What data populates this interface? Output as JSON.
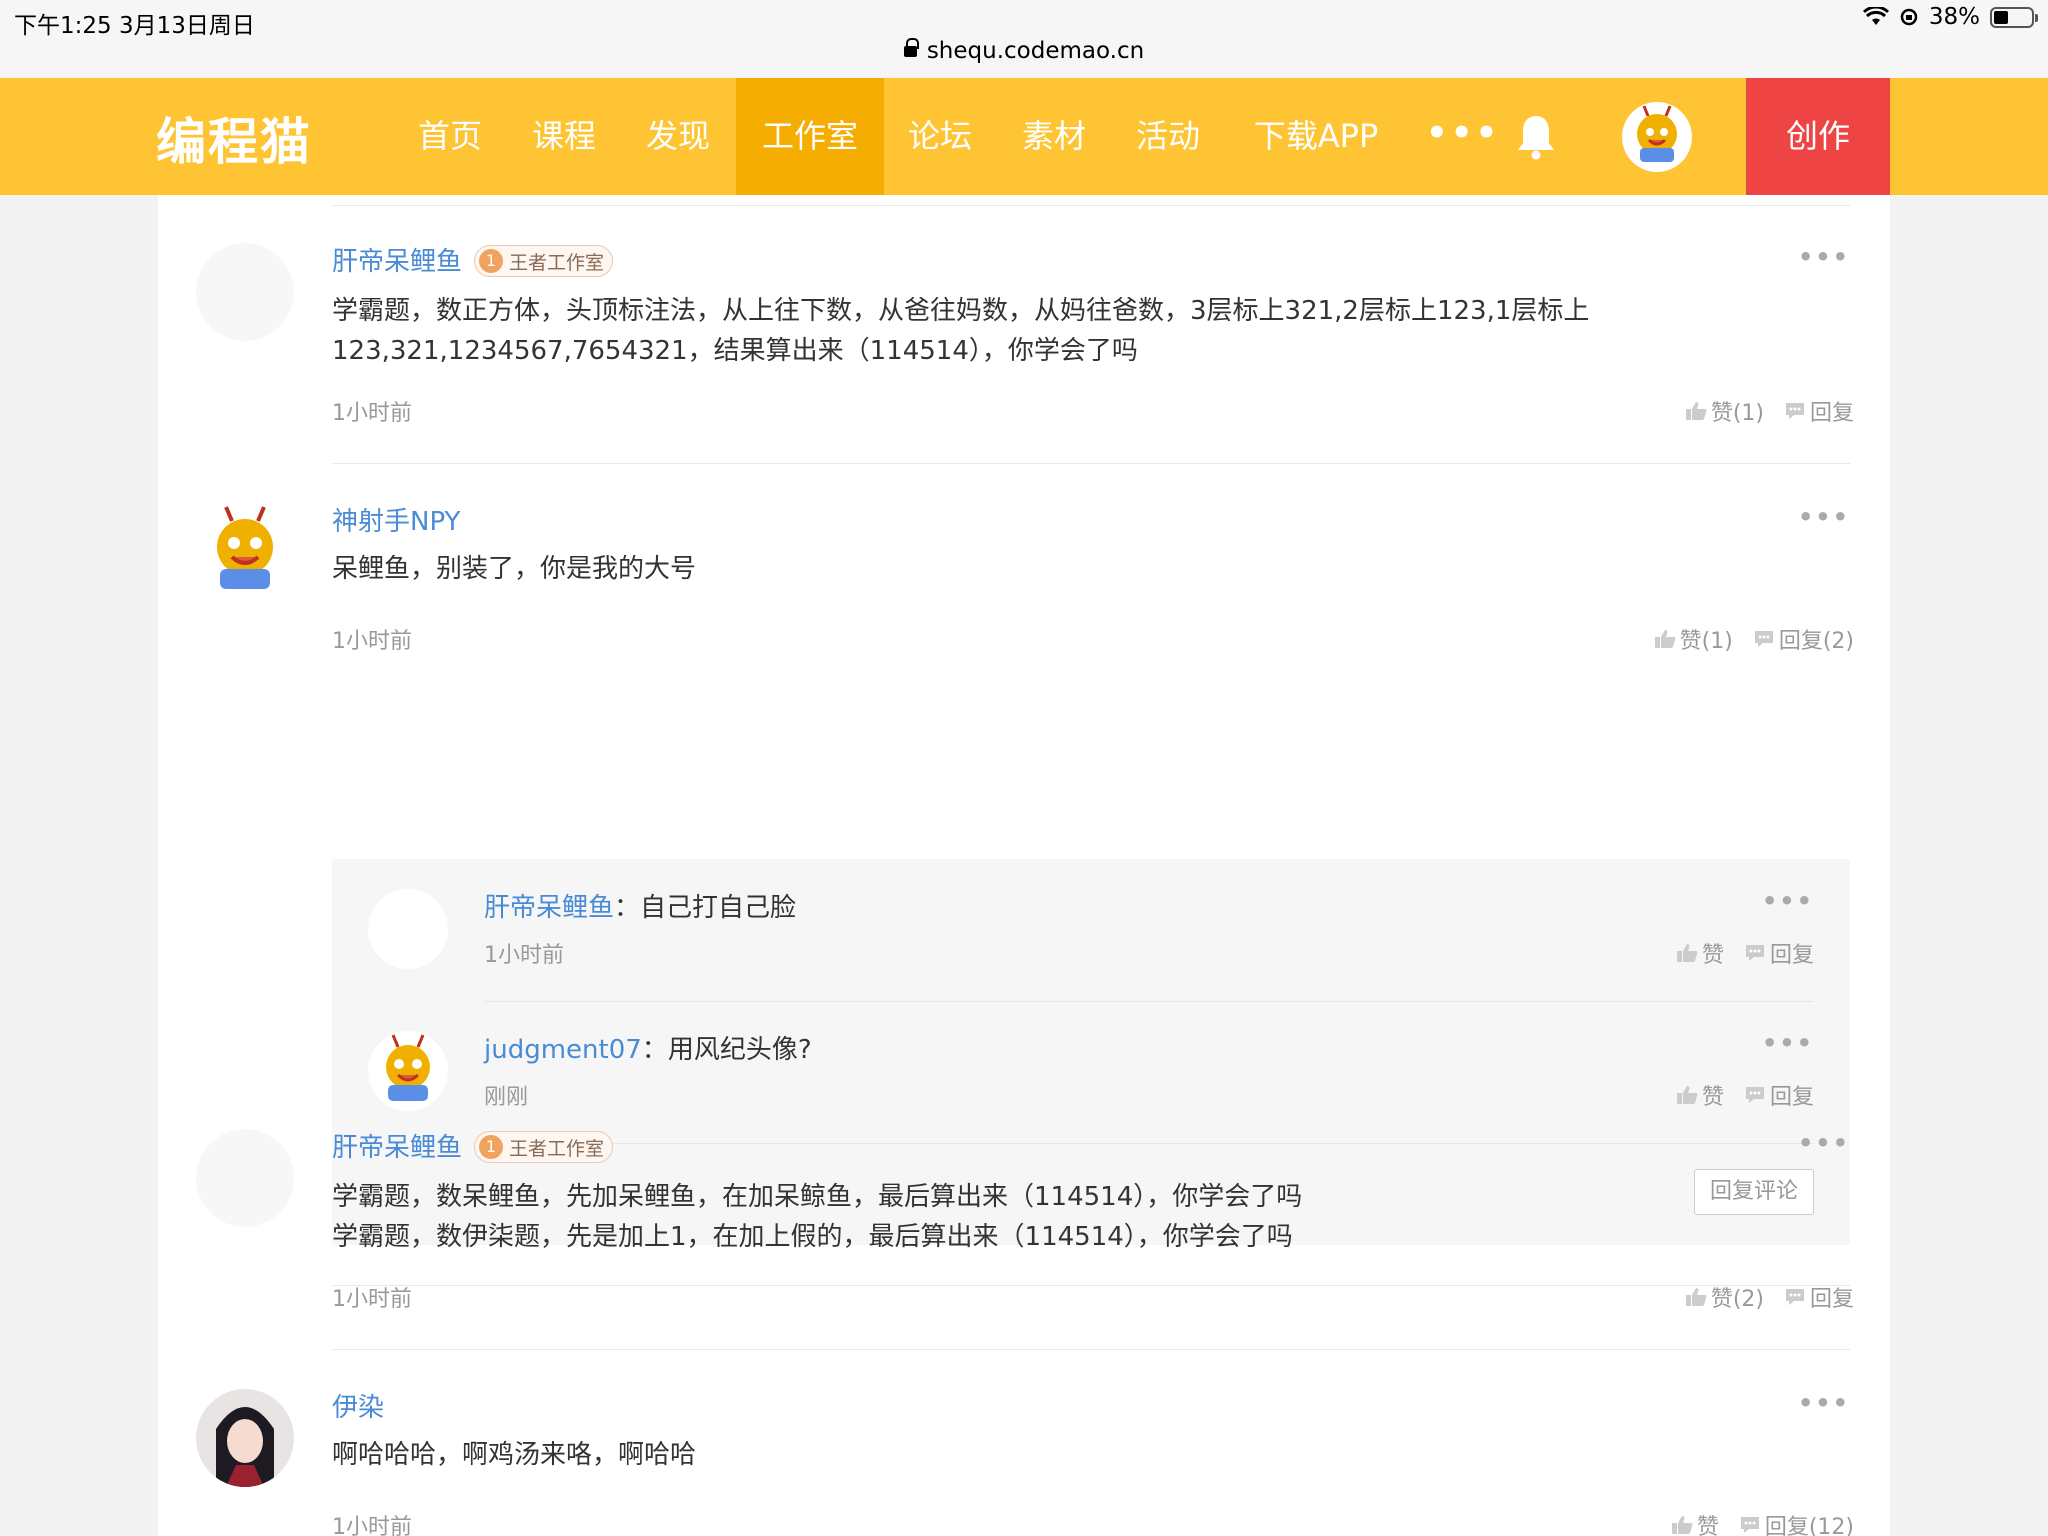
{
  "status_bar": {
    "time": "下午1:25   3月13日周日",
    "url": "shequ.codemao.cn",
    "battery": "38%",
    "battery_level": 0.38
  },
  "nav": {
    "logo": "编程猫",
    "items": [
      "首页",
      "课程",
      "发现",
      "工作室",
      "论坛",
      "素材",
      "活动",
      "下载APP"
    ],
    "active": "工作室",
    "more": "•••",
    "create": "创作",
    "colors": {
      "bar": "#fec433",
      "active": "#f4ad00",
      "create": "#ef4444"
    }
  },
  "comments": [
    {
      "name": "肝帝呆鲤鱼",
      "badge_num": "1",
      "badge": "王者工作室",
      "body_lines": [
        "学霸题，数正方体，头顶标注法，从上往下数，从爸往妈数，从妈往爸数，3层标上321,2层标上123,1层标上",
        "123,321,1234567,7654321，结果算出来（114514），你学会了吗"
      ],
      "time": "1小时前",
      "like": "赞(1)",
      "reply": "回复"
    },
    {
      "name": "神射手NPY",
      "body_lines": [
        "呆鲤鱼，别装了，你是我的大号"
      ],
      "time": "1小时前",
      "like": "赞(1)",
      "reply": "回复(2)",
      "replies": [
        {
          "name": "肝帝呆鲤鱼",
          "sep": "：",
          "text": "自己打自己脸",
          "time": "1小时前",
          "like": "赞",
          "reply": "回复"
        },
        {
          "name": "judgment07",
          "sep": "：",
          "text": "用风纪头像?",
          "time": "刚刚",
          "like": "赞",
          "reply": "回复"
        }
      ],
      "reply_button": "回复评论"
    },
    {
      "name": "肝帝呆鲤鱼",
      "badge_num": "1",
      "badge": "王者工作室",
      "body_lines": [
        "学霸题，数呆鲤鱼，先加呆鲤鱼，在加呆鲸鱼，最后算出来（114514），你学会了吗",
        "学霸题，数伊柒题，先是加上1，在加上假的，最后算出来（114514），你学会了吗"
      ],
      "time": "1小时前",
      "like": "赞(2)",
      "reply": "回复"
    },
    {
      "name": "伊染",
      "body_lines": [
        "啊哈哈哈，啊鸡汤来咯，啊哈哈"
      ],
      "time": "1小时前",
      "like": "赞",
      "reply": "回复(12)"
    }
  ]
}
